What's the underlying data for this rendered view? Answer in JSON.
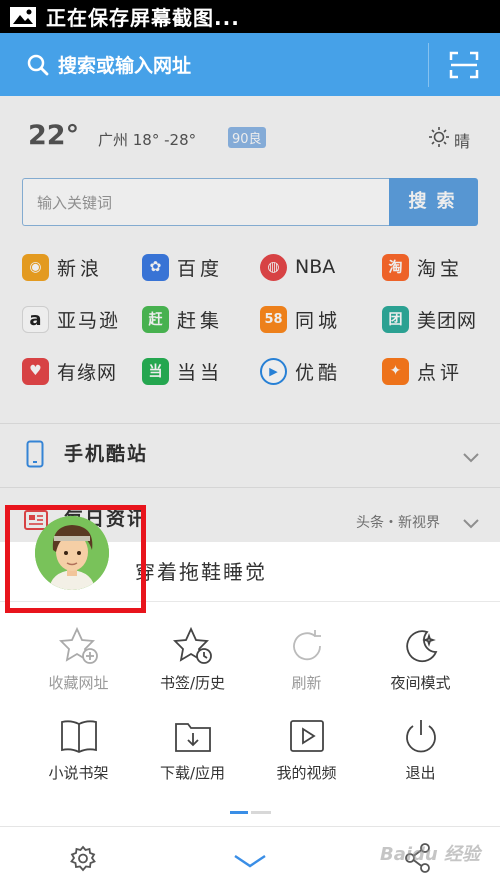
{
  "status_bar": {
    "text": "正在保存屏幕截图..."
  },
  "header": {
    "search_placeholder": "搜索或输入网址"
  },
  "weather": {
    "temperature": "22°",
    "city_range": "广州 18° -28°",
    "aqi": "90良",
    "condition": "晴"
  },
  "keyword_search": {
    "placeholder": "输入关键词",
    "button": "搜索"
  },
  "quick_links": [
    {
      "label": "新浪",
      "icon": "sina-icon",
      "color": "#f5a623",
      "glyph": "◉"
    },
    {
      "label": "百度",
      "icon": "baidu-icon",
      "color": "#3d7ce6",
      "glyph": "✿"
    },
    {
      "label": "NBA",
      "icon": "nba-icon",
      "color": "#e8484a",
      "glyph": "◍"
    },
    {
      "label": "淘宝",
      "icon": "taobao-icon",
      "color": "#ff6a2c",
      "glyph": "淘"
    },
    {
      "label": "亚马逊",
      "icon": "amazon-icon",
      "color": "#ffffff",
      "glyph": "a"
    },
    {
      "label": "赶集",
      "icon": "ganji-icon",
      "color": "#4dbf56",
      "glyph": "赶"
    },
    {
      "label": "同城",
      "icon": "tongcheng-icon",
      "color": "#ff8a1e",
      "glyph": "58"
    },
    {
      "label": "美团网",
      "icon": "meituan-icon",
      "color": "#2fae9e",
      "glyph": "团"
    },
    {
      "label": "有缘网",
      "icon": "youyuan-icon",
      "color": "#e8484a",
      "glyph": "♥"
    },
    {
      "label": "当当",
      "icon": "dangdang-icon",
      "color": "#27b356",
      "glyph": "当"
    },
    {
      "label": "优酷",
      "icon": "youku-icon",
      "color": "#ffffff",
      "glyph": "▶"
    },
    {
      "label": "点评",
      "icon": "dianping-icon",
      "color": "#ff7b1c",
      "glyph": "✦"
    }
  ],
  "sections": {
    "mobile_sites": "手机酷站",
    "daily_news": "每日资讯",
    "news_sources": "头条・新视界"
  },
  "user": {
    "name": "穿着拖鞋睡觉"
  },
  "menu": [
    {
      "label": "收藏网址",
      "icon": "bookmark-add-icon",
      "enabled": false
    },
    {
      "label": "书签/历史",
      "icon": "bookmark-history-icon",
      "enabled": true
    },
    {
      "label": "刷新",
      "icon": "refresh-icon",
      "enabled": false
    },
    {
      "label": "夜间模式",
      "icon": "night-mode-icon",
      "enabled": true
    },
    {
      "label": "小说书架",
      "icon": "book-icon",
      "enabled": true
    },
    {
      "label": "下载/应用",
      "icon": "download-icon",
      "enabled": true
    },
    {
      "label": "我的视频",
      "icon": "video-icon",
      "enabled": true
    },
    {
      "label": "退出",
      "icon": "power-icon",
      "enabled": true
    }
  ],
  "pager": {
    "current_page": 1,
    "total_pages": 2
  },
  "watermark": "Baidu 经验",
  "colors": {
    "header": "#46a1e8",
    "accent": "#3a8ee6",
    "highlight": "#e8141c"
  }
}
